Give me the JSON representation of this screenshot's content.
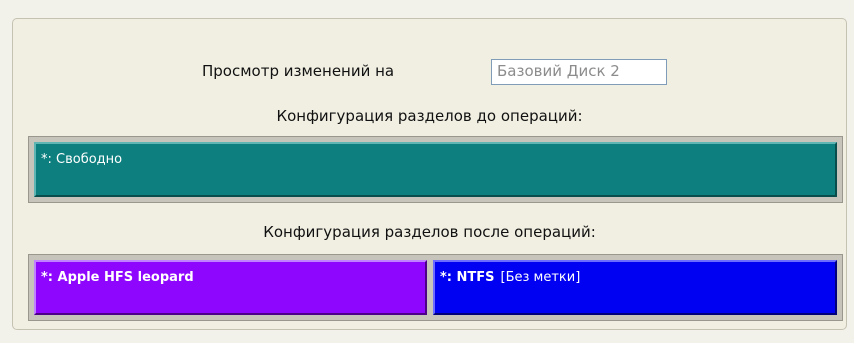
{
  "preview": {
    "label": "Просмотр изменений на",
    "disk_value": "Базовий Диск 2"
  },
  "before": {
    "heading": "Конфигурация разделов до операций:",
    "partitions": [
      {
        "text": "*: Свободно",
        "color": "#0e7f7f"
      }
    ]
  },
  "after": {
    "heading": "Конфигурация разделов после операций:",
    "partitions": [
      {
        "text": "*: Apple HFS leopard",
        "color": "#8f06ff"
      },
      {
        "type_text": "*: NTFS",
        "label_text": "[Без метки]",
        "color": "#0000f2"
      }
    ]
  }
}
